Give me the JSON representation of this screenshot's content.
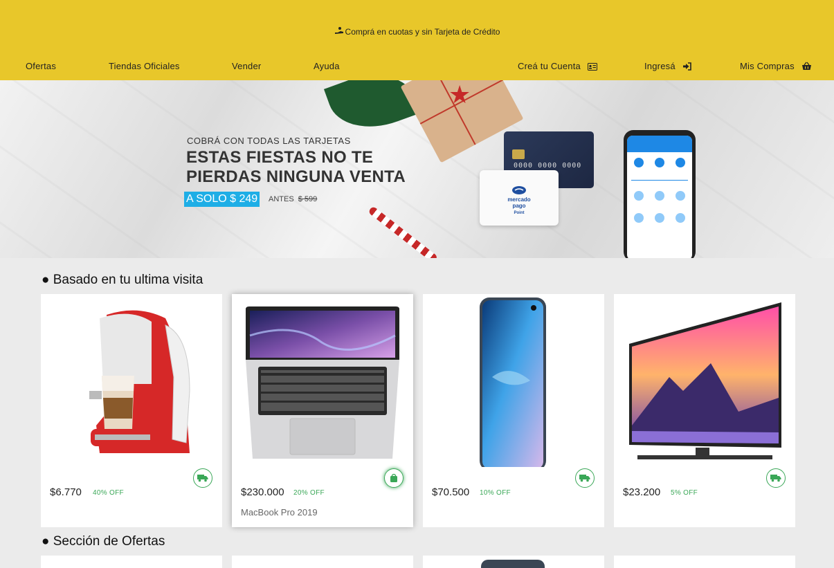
{
  "header": {
    "promo_icon": "hand-money-icon",
    "promo": "Comprá en cuotas y sin Tarjeta de Crédito",
    "nav_left": [
      "Ofertas",
      "Tiendas Oficiales",
      "Vender",
      "Ayuda"
    ],
    "create_account": "Creá tu Cuenta",
    "login": "Ingresá",
    "my_purchases": "Mis Compras",
    "bg_color": "#e8c72a"
  },
  "hero": {
    "line1": "COBRÁ CON TODAS LAS TARJETAS",
    "line2": "ESTAS FIESTAS NO TE",
    "line3": "PIERDAS NINGUNA VENTA",
    "price": "A SOLO $ 249",
    "antes_label": "ANTES",
    "antes_price": "$ 599",
    "card_number": "0000 0000 0000 0000",
    "point_logo_1": "mercado",
    "point_logo_2": "pago",
    "point_logo_3": "Point"
  },
  "sections": {
    "recent": "● Basado en tu ultima visita",
    "offers": "● Sección de Ofertas"
  },
  "products": [
    {
      "price": "$6.770",
      "off": "40% OFF",
      "name": "",
      "badge_icon": "truck-icon"
    },
    {
      "price": "$230.000",
      "off": "20% OFF",
      "name": "MacBook Pro 2019",
      "badge_icon": "bag-icon"
    },
    {
      "price": "$70.500",
      "off": "10% OFF",
      "name": "",
      "badge_icon": "truck-icon"
    },
    {
      "price": "$23.200",
      "off": "5% OFF",
      "name": "",
      "badge_icon": "truck-icon"
    }
  ],
  "colors": {
    "accent_green": "#3aa757",
    "hero_price_bg": "#1eaee6"
  }
}
